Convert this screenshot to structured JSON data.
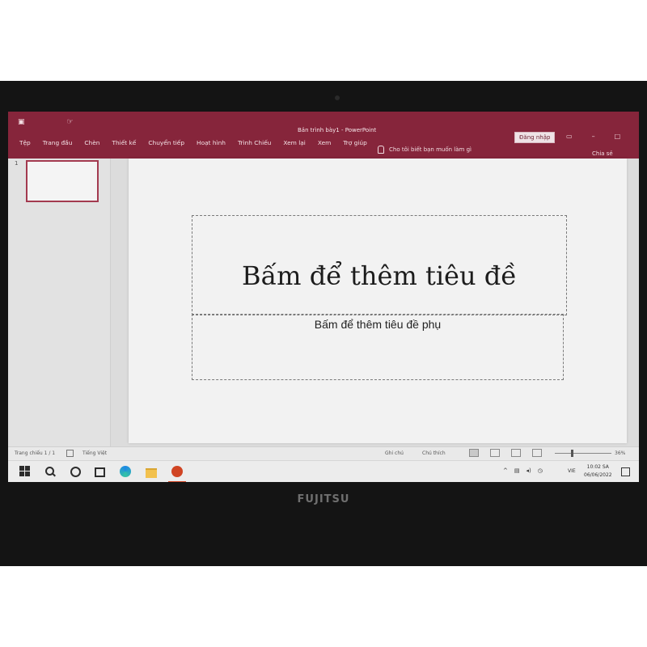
{
  "window": {
    "title": "Bản trình bày1 - PowerPoint",
    "sign_in": "Đăng nhập",
    "share": "Chia sẻ"
  },
  "ribbon": {
    "tabs": [
      "Tệp",
      "Trang đầu",
      "Chèn",
      "Thiết kế",
      "Chuyển tiếp",
      "Hoạt hình",
      "Trình Chiếu",
      "Xem lại",
      "Xem",
      "Trợ giúp"
    ],
    "tell_me": "Cho tôi biết bạn muốn làm gì"
  },
  "slides_pane": {
    "slide_number": "1"
  },
  "slide": {
    "title_placeholder": "Bấm để thêm tiêu đề",
    "subtitle_placeholder": "Bấm để thêm tiêu đề phụ"
  },
  "status_bar": {
    "slide_indicator": "Trang chiếu 1 / 1",
    "language": "Tiếng Việt",
    "notes": "Ghi chú",
    "comments": "Chú thích",
    "zoom": "36%"
  },
  "taskbar": {
    "input_lang": "VIE",
    "time": "10:02 SA",
    "date": "06/06/2022"
  },
  "device": {
    "brand": "FUJITSU"
  },
  "colors": {
    "ribbon": "#86253b",
    "powerpoint_accent": "#d04423"
  }
}
